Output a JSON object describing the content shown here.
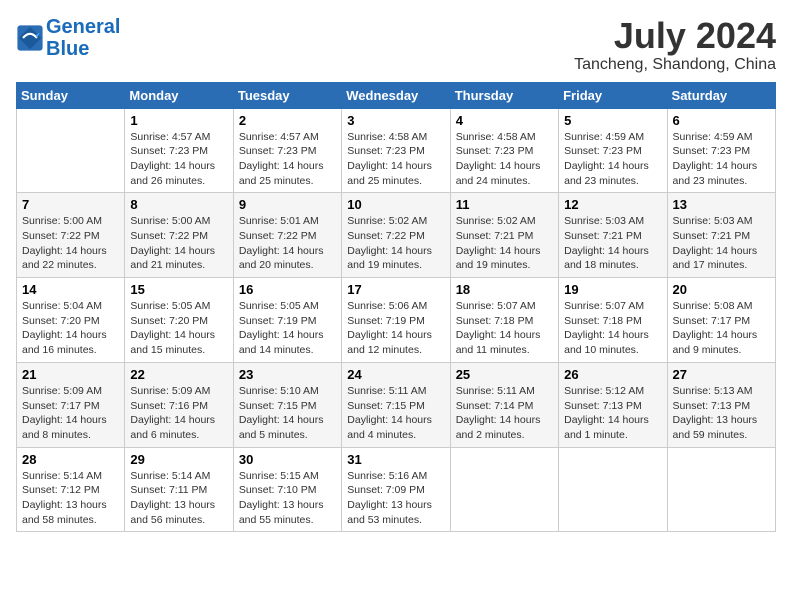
{
  "logo": {
    "line1": "General",
    "line2": "Blue"
  },
  "title": "July 2024",
  "location": "Tancheng, Shandong, China",
  "days_header": [
    "Sunday",
    "Monday",
    "Tuesday",
    "Wednesday",
    "Thursday",
    "Friday",
    "Saturday"
  ],
  "weeks": [
    [
      {
        "day": "",
        "info": ""
      },
      {
        "day": "1",
        "info": "Sunrise: 4:57 AM\nSunset: 7:23 PM\nDaylight: 14 hours\nand 26 minutes."
      },
      {
        "day": "2",
        "info": "Sunrise: 4:57 AM\nSunset: 7:23 PM\nDaylight: 14 hours\nand 25 minutes."
      },
      {
        "day": "3",
        "info": "Sunrise: 4:58 AM\nSunset: 7:23 PM\nDaylight: 14 hours\nand 25 minutes."
      },
      {
        "day": "4",
        "info": "Sunrise: 4:58 AM\nSunset: 7:23 PM\nDaylight: 14 hours\nand 24 minutes."
      },
      {
        "day": "5",
        "info": "Sunrise: 4:59 AM\nSunset: 7:23 PM\nDaylight: 14 hours\nand 23 minutes."
      },
      {
        "day": "6",
        "info": "Sunrise: 4:59 AM\nSunset: 7:23 PM\nDaylight: 14 hours\nand 23 minutes."
      }
    ],
    [
      {
        "day": "7",
        "info": "Sunrise: 5:00 AM\nSunset: 7:22 PM\nDaylight: 14 hours\nand 22 minutes."
      },
      {
        "day": "8",
        "info": "Sunrise: 5:00 AM\nSunset: 7:22 PM\nDaylight: 14 hours\nand 21 minutes."
      },
      {
        "day": "9",
        "info": "Sunrise: 5:01 AM\nSunset: 7:22 PM\nDaylight: 14 hours\nand 20 minutes."
      },
      {
        "day": "10",
        "info": "Sunrise: 5:02 AM\nSunset: 7:22 PM\nDaylight: 14 hours\nand 19 minutes."
      },
      {
        "day": "11",
        "info": "Sunrise: 5:02 AM\nSunset: 7:21 PM\nDaylight: 14 hours\nand 19 minutes."
      },
      {
        "day": "12",
        "info": "Sunrise: 5:03 AM\nSunset: 7:21 PM\nDaylight: 14 hours\nand 18 minutes."
      },
      {
        "day": "13",
        "info": "Sunrise: 5:03 AM\nSunset: 7:21 PM\nDaylight: 14 hours\nand 17 minutes."
      }
    ],
    [
      {
        "day": "14",
        "info": "Sunrise: 5:04 AM\nSunset: 7:20 PM\nDaylight: 14 hours\nand 16 minutes."
      },
      {
        "day": "15",
        "info": "Sunrise: 5:05 AM\nSunset: 7:20 PM\nDaylight: 14 hours\nand 15 minutes."
      },
      {
        "day": "16",
        "info": "Sunrise: 5:05 AM\nSunset: 7:19 PM\nDaylight: 14 hours\nand 14 minutes."
      },
      {
        "day": "17",
        "info": "Sunrise: 5:06 AM\nSunset: 7:19 PM\nDaylight: 14 hours\nand 12 minutes."
      },
      {
        "day": "18",
        "info": "Sunrise: 5:07 AM\nSunset: 7:18 PM\nDaylight: 14 hours\nand 11 minutes."
      },
      {
        "day": "19",
        "info": "Sunrise: 5:07 AM\nSunset: 7:18 PM\nDaylight: 14 hours\nand 10 minutes."
      },
      {
        "day": "20",
        "info": "Sunrise: 5:08 AM\nSunset: 7:17 PM\nDaylight: 14 hours\nand 9 minutes."
      }
    ],
    [
      {
        "day": "21",
        "info": "Sunrise: 5:09 AM\nSunset: 7:17 PM\nDaylight: 14 hours\nand 8 minutes."
      },
      {
        "day": "22",
        "info": "Sunrise: 5:09 AM\nSunset: 7:16 PM\nDaylight: 14 hours\nand 6 minutes."
      },
      {
        "day": "23",
        "info": "Sunrise: 5:10 AM\nSunset: 7:15 PM\nDaylight: 14 hours\nand 5 minutes."
      },
      {
        "day": "24",
        "info": "Sunrise: 5:11 AM\nSunset: 7:15 PM\nDaylight: 14 hours\nand 4 minutes."
      },
      {
        "day": "25",
        "info": "Sunrise: 5:11 AM\nSunset: 7:14 PM\nDaylight: 14 hours\nand 2 minutes."
      },
      {
        "day": "26",
        "info": "Sunrise: 5:12 AM\nSunset: 7:13 PM\nDaylight: 14 hours\nand 1 minute."
      },
      {
        "day": "27",
        "info": "Sunrise: 5:13 AM\nSunset: 7:13 PM\nDaylight: 13 hours\nand 59 minutes."
      }
    ],
    [
      {
        "day": "28",
        "info": "Sunrise: 5:14 AM\nSunset: 7:12 PM\nDaylight: 13 hours\nand 58 minutes."
      },
      {
        "day": "29",
        "info": "Sunrise: 5:14 AM\nSunset: 7:11 PM\nDaylight: 13 hours\nand 56 minutes."
      },
      {
        "day": "30",
        "info": "Sunrise: 5:15 AM\nSunset: 7:10 PM\nDaylight: 13 hours\nand 55 minutes."
      },
      {
        "day": "31",
        "info": "Sunrise: 5:16 AM\nSunset: 7:09 PM\nDaylight: 13 hours\nand 53 minutes."
      },
      {
        "day": "",
        "info": ""
      },
      {
        "day": "",
        "info": ""
      },
      {
        "day": "",
        "info": ""
      }
    ]
  ]
}
